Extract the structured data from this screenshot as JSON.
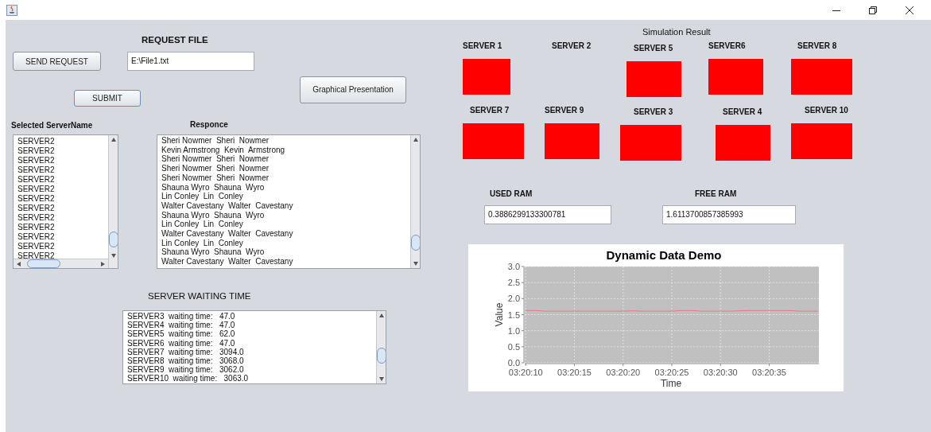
{
  "request_file": {
    "heading": "REQUEST FILE",
    "send_button": "SEND REQUEST",
    "file_path": "E:\\File1.txt",
    "submit_button": "SUBMIT",
    "graph_button": "Graphical Presentation"
  },
  "selected_servers": {
    "heading": "Selected ServerName",
    "items": [
      "SERVER2",
      "SERVER2",
      "SERVER2",
      "SERVER2",
      "SERVER2",
      "SERVER2",
      "SERVER2",
      "SERVER2",
      "SERVER2",
      "SERVER2",
      "SERVER2",
      "SERVER2",
      "SERVER2"
    ]
  },
  "response": {
    "heading": "Responce",
    "items": [
      "Sheri Nowmer  Sheri  Nowmer",
      "Kevin Armstrong  Kevin  Armstrong",
      "Sheri Nowmer  Sheri  Nowmer",
      "Sheri Nowmer  Sheri  Nowmer",
      "Sheri Nowmer  Sheri  Nowmer",
      "Shauna Wyro  Shauna  Wyro",
      "Lin Conley  Lin  Conley",
      "Walter Cavestany  Walter  Cavestany",
      "Shauna Wyro  Shauna  Wyro",
      "Lin Conley  Lin  Conley",
      "Walter Cavestany  Walter  Cavestany",
      "Lin Conley  Lin  Conley",
      "Shauna Wyro  Shauna  Wyro",
      "Walter Cavestany  Walter  Cavestany"
    ]
  },
  "waiting_time": {
    "heading": "SERVER WAITING TIME",
    "items": [
      "SERVER3  waiting time:   47.0",
      "SERVER4  waiting time:   47.0",
      "SERVER5  waiting time:   62.0",
      "SERVER6  waiting time:   47.0",
      "SERVER7  waiting time:   3094.0",
      "SERVER8  waiting time:   3068.0",
      "SERVER9  waiting time:   3062.0",
      "SERVER10  waiting time:   3063.0"
    ]
  },
  "simulation": {
    "title": "Simulation Result",
    "servers": [
      {
        "label": "SERVER 1",
        "active": true
      },
      {
        "label": "SERVER 2",
        "active": false
      },
      {
        "label": "SERVER 5",
        "active": true
      },
      {
        "label": "SERVER6",
        "active": true
      },
      {
        "label": "SERVER 8",
        "active": true
      },
      {
        "label": "SERVER 7",
        "active": true
      },
      {
        "label": "SERVER 9",
        "active": true
      },
      {
        "label": "SERVER 3",
        "active": true
      },
      {
        "label": "SERVER 4",
        "active": true
      },
      {
        "label": "SERVER 10",
        "active": true
      }
    ],
    "used_ram_label": "USED RAM",
    "used_ram": "0.3886299133300781",
    "free_ram_label": "FREE RAM",
    "free_ram": "1.6113700857385993"
  },
  "chart": {
    "chart_data": {
      "type": "line",
      "title": "Dynamic Data Demo",
      "xlabel": "Time",
      "ylabel": "Value",
      "categories": [
        "03:20:10",
        null,
        null,
        null,
        null,
        "03:20:15",
        null,
        null,
        null,
        null,
        "03:20:20",
        null,
        null,
        null,
        null,
        "03:20:25",
        null,
        null,
        null,
        null,
        "03:20:30",
        null,
        null,
        null,
        null,
        "03:20:35",
        null,
        null,
        null,
        null,
        null
      ],
      "series": [
        {
          "color": "#e87878",
          "values": [
            1.63,
            1.63,
            1.61,
            1.61,
            1.61,
            1.61,
            1.61,
            1.61,
            1.61,
            1.61,
            1.61,
            1.62,
            1.61,
            1.61,
            1.61,
            1.61,
            1.63,
            1.63,
            1.61,
            1.61,
            1.61,
            1.61,
            1.62,
            1.63,
            1.63,
            1.63,
            1.63,
            1.63,
            1.61,
            1.61,
            1.61
          ]
        }
      ],
      "ylim": [
        0,
        3
      ],
      "grid": true,
      "yticks": [
        {
          "value": 0,
          "label": "0.0"
        },
        {
          "value": 0.5,
          "label": "0.5"
        },
        {
          "value": 1,
          "label": "1.0"
        },
        {
          "value": 1.5,
          "label": "1.5"
        },
        {
          "value": 2,
          "label": "2.0"
        },
        {
          "value": 2.5,
          "label": "2.5"
        },
        {
          "value": 3,
          "label": "3.0"
        }
      ]
    }
  }
}
